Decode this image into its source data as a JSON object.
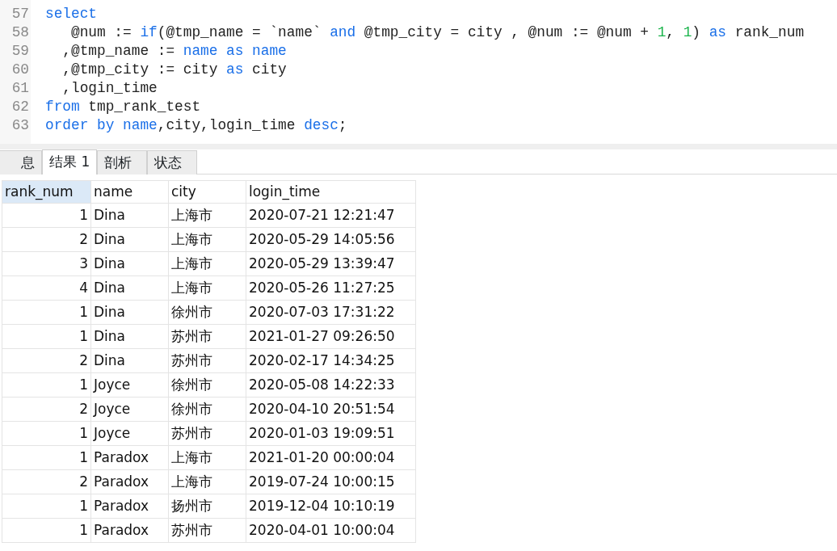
{
  "editor": {
    "lines": [
      {
        "number": "57",
        "tokens": [
          {
            "kind": "keyword",
            "text": "select"
          }
        ]
      },
      {
        "number": "58",
        "tokens": [
          {
            "kind": "plain",
            "text": "   @num := "
          },
          {
            "kind": "keyword",
            "text": "if"
          },
          {
            "kind": "plain",
            "text": "(@tmp_name = `name` "
          },
          {
            "kind": "keyword",
            "text": "and"
          },
          {
            "kind": "plain",
            "text": " @tmp_city = city , @num := @num + "
          },
          {
            "kind": "number",
            "text": "1"
          },
          {
            "kind": "plain",
            "text": ", "
          },
          {
            "kind": "number",
            "text": "1"
          },
          {
            "kind": "plain",
            "text": ") "
          },
          {
            "kind": "keyword",
            "text": "as"
          },
          {
            "kind": "plain",
            "text": " rank_num"
          }
        ]
      },
      {
        "number": "59",
        "tokens": [
          {
            "kind": "plain",
            "text": "  ,@tmp_name := "
          },
          {
            "kind": "keyword",
            "text": "name as name"
          }
        ]
      },
      {
        "number": "60",
        "tokens": [
          {
            "kind": "plain",
            "text": "  ,@tmp_city := city "
          },
          {
            "kind": "keyword",
            "text": "as"
          },
          {
            "kind": "plain",
            "text": " city"
          }
        ]
      },
      {
        "number": "61",
        "tokens": [
          {
            "kind": "plain",
            "text": "  ,login_time"
          }
        ]
      },
      {
        "number": "62",
        "tokens": [
          {
            "kind": "keyword",
            "text": "from"
          },
          {
            "kind": "plain",
            "text": " tmp_rank_test"
          }
        ]
      },
      {
        "number": "63",
        "tokens": [
          {
            "kind": "keyword",
            "text": "order by name"
          },
          {
            "kind": "plain",
            "text": ",city,login_time "
          },
          {
            "kind": "keyword",
            "text": "desc"
          },
          {
            "kind": "plain",
            "text": ";"
          }
        ]
      }
    ]
  },
  "tabs": [
    {
      "label": "息",
      "selected": false
    },
    {
      "label": "结果 1",
      "selected": true
    },
    {
      "label": "剖析",
      "selected": false
    },
    {
      "label": "状态",
      "selected": false
    }
  ],
  "table": {
    "columns": [
      {
        "label": "rank_num",
        "selected": true
      },
      {
        "label": "name",
        "selected": false
      },
      {
        "label": "city",
        "selected": false
      },
      {
        "label": "login_time",
        "selected": false
      }
    ],
    "rows": [
      [
        "1",
        "Dina",
        "上海市",
        "2020-07-21 12:21:47"
      ],
      [
        "2",
        "Dina",
        "上海市",
        "2020-05-29 14:05:56"
      ],
      [
        "3",
        "Dina",
        "上海市",
        "2020-05-29 13:39:47"
      ],
      [
        "4",
        "Dina",
        "上海市",
        "2020-05-26 11:27:25"
      ],
      [
        "1",
        "Dina",
        "徐州市",
        "2020-07-03 17:31:22"
      ],
      [
        "1",
        "Dina",
        "苏州市",
        "2021-01-27 09:26:50"
      ],
      [
        "2",
        "Dina",
        "苏州市",
        "2020-02-17 14:34:25"
      ],
      [
        "1",
        "Joyce",
        "徐州市",
        "2020-05-08 14:22:33"
      ],
      [
        "2",
        "Joyce",
        "徐州市",
        "2020-04-10 20:51:54"
      ],
      [
        "1",
        "Joyce",
        "苏州市",
        "2020-01-03 19:09:51"
      ],
      [
        "1",
        "Paradox",
        "上海市",
        "2021-01-20 00:00:04"
      ],
      [
        "2",
        "Paradox",
        "上海市",
        "2019-07-24 10:00:15"
      ],
      [
        "1",
        "Paradox",
        "扬州市",
        "2019-12-04 10:10:19"
      ],
      [
        "1",
        "Paradox",
        "苏州市",
        "2020-04-01 10:00:04"
      ]
    ]
  }
}
